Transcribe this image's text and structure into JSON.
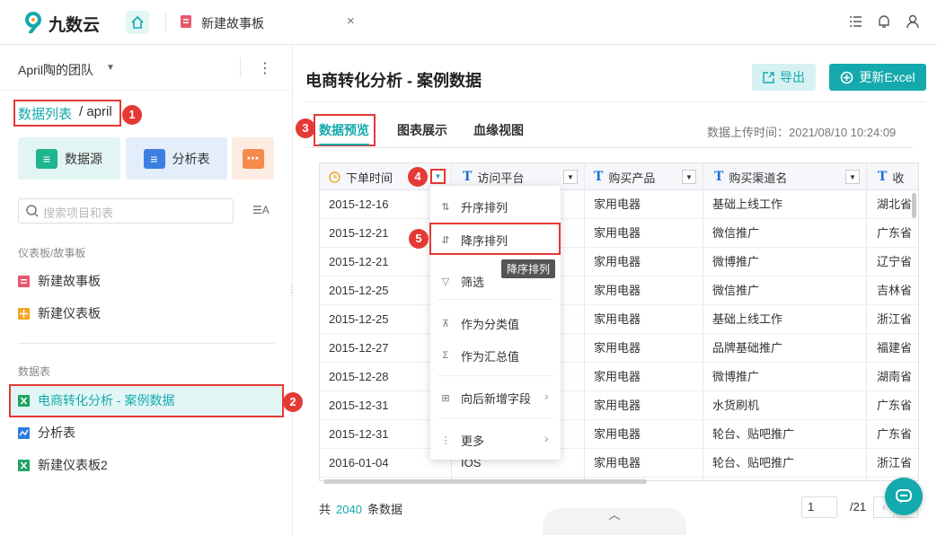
{
  "app": {
    "logo_text": "九数云",
    "brand_color": "#14a9ad"
  },
  "topbar": {
    "tab_label": "新建故事板",
    "tab_close": "×",
    "icons": [
      "home-icon",
      "list-icon",
      "bell-icon",
      "user-icon"
    ]
  },
  "sidebar": {
    "team": "April陶的团队",
    "team_caret": "▼",
    "kebab": "⋮",
    "breadcrumb": {
      "link": "数据列表",
      "rest": "/ april"
    },
    "cards": [
      {
        "label": "数据源"
      },
      {
        "label": "分析表"
      },
      {
        "label": ""
      }
    ],
    "search_placeholder": "搜索项目和表",
    "sort_label": "☰A",
    "sections": [
      {
        "title": "仪表板/故事板",
        "items": [
          "新建故事板",
          "新建仪表板"
        ]
      },
      {
        "title": "数据表",
        "items": [
          "电商转化分析 - 案例数据",
          "分析表",
          "新建仪表板2"
        ]
      }
    ]
  },
  "main": {
    "title": "电商转化分析 - 案例数据",
    "export_label": "导出",
    "update_label": "更新Excel",
    "tabs": [
      "数据预览",
      "图表展示",
      "血缘视图"
    ],
    "upload_time": "数据上传时间：2021/08/10 10:24:09"
  },
  "table": {
    "columns": [
      "下单时间",
      "访问平台",
      "购买产品",
      "购买渠道名",
      "收"
    ],
    "column_types": [
      "T",
      "T",
      "T",
      "T",
      "T"
    ],
    "rows": [
      [
        "2015-12-16",
        "",
        "家用电器",
        "基础上线工作",
        "湖北省"
      ],
      [
        "2015-12-21",
        "",
        "家用电器",
        "微信推广",
        "广东省"
      ],
      [
        "2015-12-21",
        "",
        "家用电器",
        "微博推广",
        "辽宁省"
      ],
      [
        "2015-12-25",
        "",
        "家用电器",
        "微信推广",
        "吉林省"
      ],
      [
        "2015-12-25",
        "",
        "家用电器",
        "基础上线工作",
        "浙江省"
      ],
      [
        "2015-12-27",
        "",
        "家用电器",
        "品牌基础推广",
        "福建省"
      ],
      [
        "2015-12-28",
        "",
        "家用电器",
        "微博推广",
        "湖南省"
      ],
      [
        "2015-12-31",
        "",
        "家用电器",
        "水货刷机",
        "广东省"
      ],
      [
        "2015-12-31",
        "",
        "家用电器",
        "轮台、贴吧推广",
        "广东省"
      ],
      [
        "2016-01-04",
        "IOS",
        "家用电器",
        "轮台、贴吧推广",
        "浙江省"
      ]
    ]
  },
  "menu": {
    "items": [
      "升序排列",
      "降序排列",
      "筛选",
      "作为分类值",
      "作为汇总值",
      "向后新增字段",
      "更多"
    ],
    "tooltip": "降序排列"
  },
  "footer": {
    "prefix": "共",
    "count": "2040",
    "suffix": "条数据",
    "page": "1",
    "page_total": "/21",
    "collapse": "︿"
  },
  "annotations": [
    "1",
    "2",
    "3",
    "4",
    "5"
  ]
}
